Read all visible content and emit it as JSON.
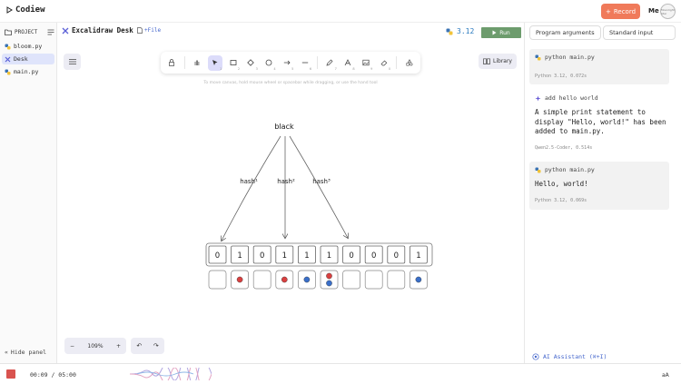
{
  "app": {
    "name": "Codiew"
  },
  "header": {
    "record_label": "Record",
    "user_label": "Me",
    "avatar_text": "Moonlight Star"
  },
  "sidebar": {
    "project_label": "PROJECT",
    "files": [
      {
        "name": "bloom.py",
        "active": false
      },
      {
        "name": "Desk",
        "active": true
      },
      {
        "name": "main.py",
        "active": false
      }
    ],
    "hide_panel_label": "Hide panel"
  },
  "editor": {
    "tab_title": "Excalidraw Desk",
    "file_button": "+File",
    "python_version": "3.12",
    "run_label": "Run"
  },
  "canvas": {
    "hint": "To move canvas, hold mouse wheel or spacebar while dragging, or use the hand tool",
    "tools": [
      {
        "name": "lock",
        "shortcut": ""
      },
      {
        "name": "hand",
        "shortcut": ""
      },
      {
        "name": "select",
        "shortcut": "1"
      },
      {
        "name": "rectangle",
        "shortcut": "2"
      },
      {
        "name": "diamond",
        "shortcut": "3"
      },
      {
        "name": "ellipse",
        "shortcut": "4"
      },
      {
        "name": "arrow",
        "shortcut": "5"
      },
      {
        "name": "line",
        "shortcut": "6"
      },
      {
        "name": "pencil",
        "shortcut": "7"
      },
      {
        "name": "text",
        "shortcut": "8"
      },
      {
        "name": "image",
        "shortcut": "9"
      },
      {
        "name": "eraser",
        "shortcut": "0"
      },
      {
        "name": "extra",
        "shortcut": ""
      }
    ],
    "library_label": "Library",
    "zoom_label": "109%",
    "drawing": {
      "root_label": "black",
      "hash_labels": [
        "hash¹",
        "hash²",
        "hash³"
      ],
      "bits": [
        "0",
        "1",
        "0",
        "1",
        "1",
        "1",
        "0",
        "0",
        "0",
        "1"
      ],
      "buckets": [
        {
          "balls": []
        },
        {
          "balls": [
            "#d94040"
          ]
        },
        {
          "balls": []
        },
        {
          "balls": [
            "#d94040"
          ]
        },
        {
          "balls": [
            "#3a6fc9"
          ]
        },
        {
          "balls": [
            "#d94040",
            "#3a6fc9"
          ]
        },
        {
          "balls": []
        },
        {
          "balls": []
        },
        {
          "balls": []
        },
        {
          "balls": [
            "#3a6fc9"
          ]
        }
      ]
    }
  },
  "right_panel": {
    "tabs": [
      "Program arguments",
      "Standard input"
    ],
    "run1": {
      "command": "python main.py",
      "meta": "Python 3.12, 0.072s"
    },
    "message": {
      "title": "add hello world",
      "body": "A simple print statement to display \"Hello, world!\" has been added to main.py.",
      "meta": "Qwen2.5-Coder, 0.514s"
    },
    "run2": {
      "command": "python main.py",
      "output": "Hello, world!",
      "meta": "Python 3.12, 0.069s"
    },
    "assistant_label": "AI Assistant (⌘+I)"
  },
  "bottom": {
    "timer": "00:09 / 05:00",
    "aa_label": "aA"
  },
  "colors": {
    "accent": "#f07a5a",
    "run": "#6d9c6d",
    "link": "#4466cc",
    "selection": "#dcdcfa"
  }
}
